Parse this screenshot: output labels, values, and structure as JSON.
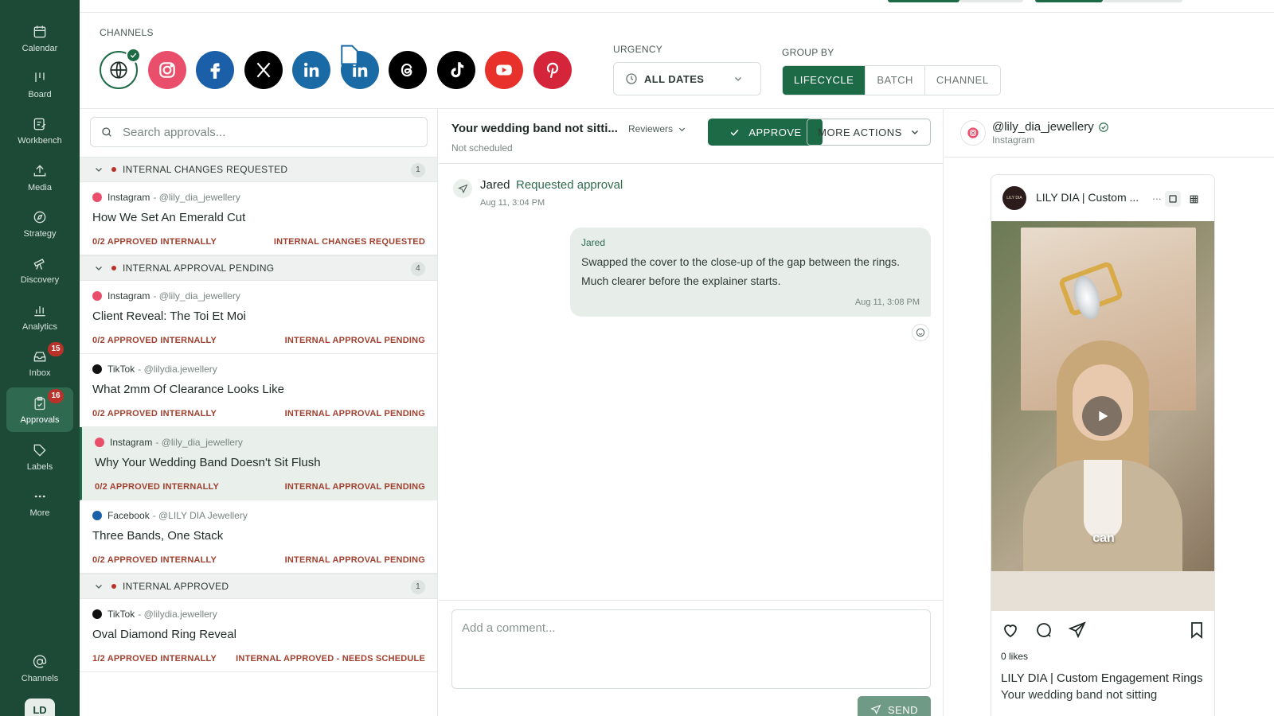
{
  "sidebar": {
    "items": [
      {
        "label": "Calendar",
        "icon": "calendar-icon"
      },
      {
        "label": "Board",
        "icon": "board-icon"
      },
      {
        "label": "Workbench",
        "icon": "workbench-icon"
      },
      {
        "label": "Media",
        "icon": "upload-icon"
      },
      {
        "label": "Strategy",
        "icon": "compass-icon"
      },
      {
        "label": "Discovery",
        "icon": "telescope-icon"
      },
      {
        "label": "Analytics",
        "icon": "bar-chart-icon"
      },
      {
        "label": "Inbox",
        "icon": "inbox-icon",
        "badge": "15"
      },
      {
        "label": "Approvals",
        "icon": "clipboard-check-icon",
        "badge": "16",
        "active": true
      },
      {
        "label": "Labels",
        "icon": "tag-icon"
      },
      {
        "label": "More",
        "icon": "more-dots-icon"
      },
      {
        "label": "Channels",
        "icon": "at-sign-icon"
      }
    ],
    "avatar_initials": "LD"
  },
  "channels": {
    "label": "CHANNELS",
    "items": [
      {
        "name": "All channels",
        "icon": "globe-icon",
        "selected": true
      },
      {
        "name": "Instagram",
        "icon": "instagram-icon",
        "color": "#E4405F"
      },
      {
        "name": "Facebook",
        "icon": "facebook-icon",
        "color": "#1877F2"
      },
      {
        "name": "X",
        "icon": "x-icon",
        "color": "#000000"
      },
      {
        "name": "LinkedIn",
        "icon": "linkedin-icon",
        "color": "#0A66C2"
      },
      {
        "name": "LinkedIn Page",
        "icon": "linkedin-page-icon",
        "color": "#0A66C2"
      },
      {
        "name": "Threads",
        "icon": "threads-icon",
        "color": "#000000"
      },
      {
        "name": "TikTok",
        "icon": "tiktok-icon",
        "color": "#000000"
      },
      {
        "name": "YouTube",
        "icon": "youtube-icon",
        "color": "#FF0000"
      },
      {
        "name": "Pinterest",
        "icon": "pinterest-icon",
        "color": "#E60023"
      }
    ]
  },
  "urgency": {
    "label": "URGENCY",
    "value": "ALL DATES"
  },
  "group_by": {
    "label": "GROUP BY",
    "options": [
      "LIFECYCLE",
      "BATCH",
      "CHANNEL"
    ],
    "selected": "LIFECYCLE"
  },
  "search": {
    "placeholder": "Search approvals..."
  },
  "groups": [
    {
      "title": "INTERNAL CHANGES REQUESTED",
      "count": "1",
      "items": [
        {
          "platform": "Instagram",
          "handle": "- @lily_dia_jewellery",
          "title": "How We Set An Emerald Cut",
          "progress": "0/2 APPROVED INTERNALLY",
          "status": "INTERNAL CHANGES REQUESTED"
        }
      ]
    },
    {
      "title": "INTERNAL APPROVAL PENDING",
      "count": "4",
      "items": [
        {
          "platform": "Instagram",
          "handle": "- @lily_dia_jewellery",
          "title": "Client Reveal: The Toi Et Moi",
          "progress": "0/2 APPROVED INTERNALLY",
          "status": "INTERNAL APPROVAL PENDING"
        },
        {
          "platform": "TikTok",
          "handle": "- @lilydia.jewellery",
          "title": "What 2mm Of Clearance Looks Like",
          "progress": "0/2 APPROVED INTERNALLY",
          "status": "INTERNAL APPROVAL PENDING"
        },
        {
          "platform": "Instagram",
          "handle": "- @lily_dia_jewellery",
          "title": "Why Your Wedding Band Doesn't Sit Flush",
          "progress": "0/2 APPROVED INTERNALLY",
          "status": "INTERNAL APPROVAL PENDING"
        },
        {
          "platform": "Facebook",
          "handle": "- @LILY DIA Jewellery",
          "title": "Three Bands, One Stack",
          "progress": "0/2 APPROVED INTERNALLY",
          "status": "INTERNAL APPROVAL PENDING"
        }
      ]
    },
    {
      "title": "INTERNAL APPROVED",
      "count": "1",
      "items": [
        {
          "platform": "TikTok",
          "handle": "- @lilydia.jewellery",
          "title": "Oval Diamond Ring Reveal",
          "progress": "1/2 APPROVED INTERNALLY",
          "status": "INTERNAL APPROVED - NEEDS SCHEDULE"
        }
      ]
    }
  ],
  "detail": {
    "title": "Your wedding band not sitti...",
    "subtitle": "Not scheduled",
    "reviewers_label": "Reviewers",
    "approve_label": "APPROVE",
    "more_actions_label": "MORE ACTIONS",
    "activity": {
      "name": "Jared",
      "action": "Requested approval",
      "time": "Aug 11, 3:04 PM"
    },
    "comment": {
      "author": "Jared",
      "text": "Swapped the cover to the close-up of the gap between the rings. Much clearer before the explainer starts.",
      "time": "Aug 11, 3:08 PM"
    },
    "comment_placeholder": "Add a comment...",
    "send_label": "SEND"
  },
  "preview": {
    "handle": "@lily_dia_jewellery",
    "platform": "Instagram",
    "account_name": "LILY DIA | Custom ...",
    "avatar_text": "LILY DIA",
    "dots": "...",
    "overlay_word": "can",
    "likes": "0 likes",
    "caption_name": "LILY DIA | Custom Engagement Rings",
    "caption_text": "Your wedding band not sitting"
  },
  "colors": {
    "sidebar": "#1d4a37",
    "accent": "#1d6b46",
    "status_red": "#a0402f"
  }
}
